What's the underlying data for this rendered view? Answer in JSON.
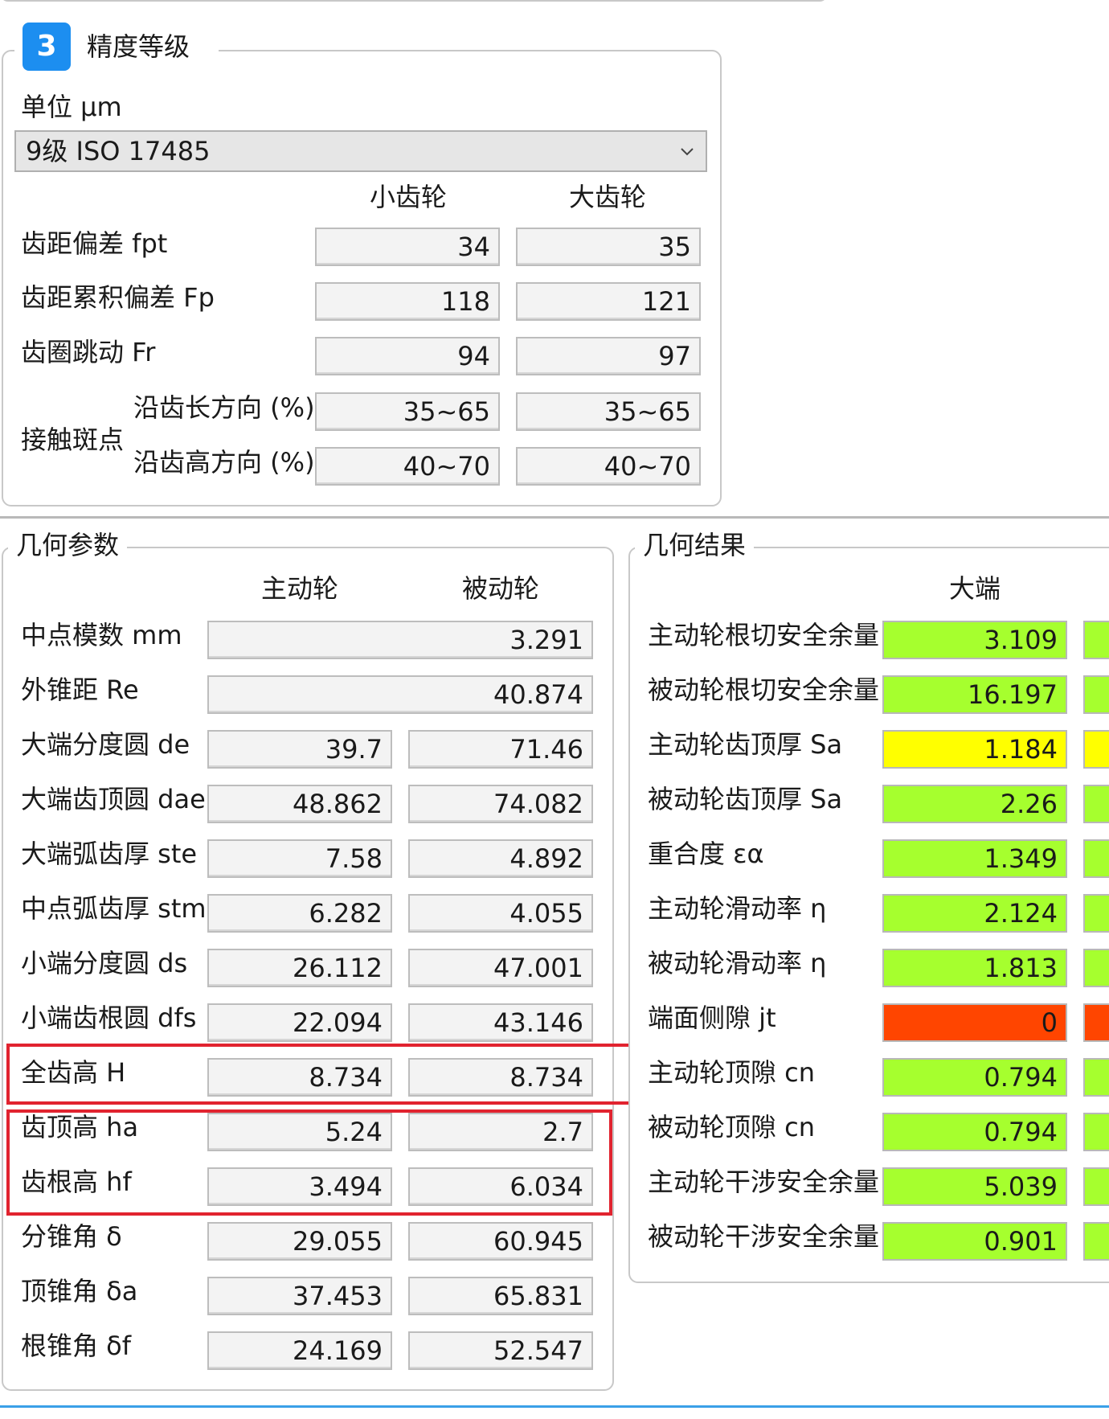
{
  "colors": {
    "badge": "#1c8ef0",
    "ok": "#a6ff2e",
    "warn": "#ffff00",
    "bad": "#ff4500",
    "highlight": "#e1232f"
  },
  "precision": {
    "badge": "3",
    "title": "精度等级",
    "unit_label": "单位 μm",
    "grade_select": "9级 ISO 17485",
    "dropdown_icon": "chevron-down-icon",
    "col_small": "小齿轮",
    "col_large": "大齿轮",
    "rows": [
      {
        "label": "齿距偏差 fpt",
        "small": "34",
        "large": "35"
      },
      {
        "label": "齿距累积偏差 Fp",
        "small": "118",
        "large": "121"
      },
      {
        "label": "齿圈跳动 Fr",
        "small": "94",
        "large": "97"
      }
    ],
    "contact_label": "接触斑点",
    "contact_rows": [
      {
        "label": "沿齿长方向 (%)",
        "small": "35~65",
        "large": "35~65"
      },
      {
        "label": "沿齿高方向 (%)",
        "small": "40~70",
        "large": "40~70"
      }
    ]
  },
  "geometry": {
    "title": "几何参数",
    "col_driving": "主动轮",
    "col_driven": "被动轮",
    "shared_rows": [
      {
        "label": "中点模数 mm",
        "value": "3.291"
      },
      {
        "label": "外锥距 Re",
        "value": "40.874"
      }
    ],
    "rows": [
      {
        "label": "大端分度圆 de",
        "driving": "39.7",
        "driven": "71.46"
      },
      {
        "label": "大端齿顶圆 dae",
        "driving": "48.862",
        "driven": "74.082"
      },
      {
        "label": "大端弧齿厚 ste",
        "driving": "7.58",
        "driven": "4.892"
      },
      {
        "label": "中点弧齿厚 stm",
        "driving": "6.282",
        "driven": "4.055"
      },
      {
        "label": "小端分度圆 ds",
        "driving": "26.112",
        "driven": "47.001"
      },
      {
        "label": "小端齿根圆 dfs",
        "driving": "22.094",
        "driven": "43.146"
      },
      {
        "label": "全齿高 H",
        "driving": "8.734",
        "driven": "8.734"
      },
      {
        "label": "齿顶高 ha",
        "driving": "5.24",
        "driven": "2.7"
      },
      {
        "label": "齿根高 hf",
        "driving": "3.494",
        "driven": "6.034"
      },
      {
        "label": "分锥角 δ",
        "driving": "29.055",
        "driven": "60.945"
      },
      {
        "label": "顶锥角 δa",
        "driving": "37.453",
        "driven": "65.831"
      },
      {
        "label": "根锥角 δf",
        "driving": "24.169",
        "driven": "52.547"
      }
    ]
  },
  "results": {
    "title": "几何结果",
    "col_big_end": "大端",
    "rows": [
      {
        "label": "主动轮根切安全余量",
        "value": "3.109",
        "status": "ok"
      },
      {
        "label": "被动轮根切安全余量",
        "value": "16.197",
        "status": "ok"
      },
      {
        "label": "主动轮齿顶厚 Sa",
        "value": "1.184",
        "status": "warn"
      },
      {
        "label": "被动轮齿顶厚 Sa",
        "value": "2.26",
        "status": "ok"
      },
      {
        "label": "重合度 εα",
        "value": "1.349",
        "status": "ok"
      },
      {
        "label": "主动轮滑动率 η",
        "value": "2.124",
        "status": "ok"
      },
      {
        "label": "被动轮滑动率 η",
        "value": "1.813",
        "status": "ok"
      },
      {
        "label": "端面侧隙 jt",
        "value": "0",
        "status": "bad"
      },
      {
        "label": "主动轮顶隙 cn",
        "value": "0.794",
        "status": "ok"
      },
      {
        "label": "被动轮顶隙 cn",
        "value": "0.794",
        "status": "ok"
      },
      {
        "label": "主动轮干涉安全余量",
        "value": "5.039",
        "status": "ok"
      },
      {
        "label": "被动轮干涉安全余量",
        "value": "0.901",
        "status": "ok"
      }
    ]
  }
}
